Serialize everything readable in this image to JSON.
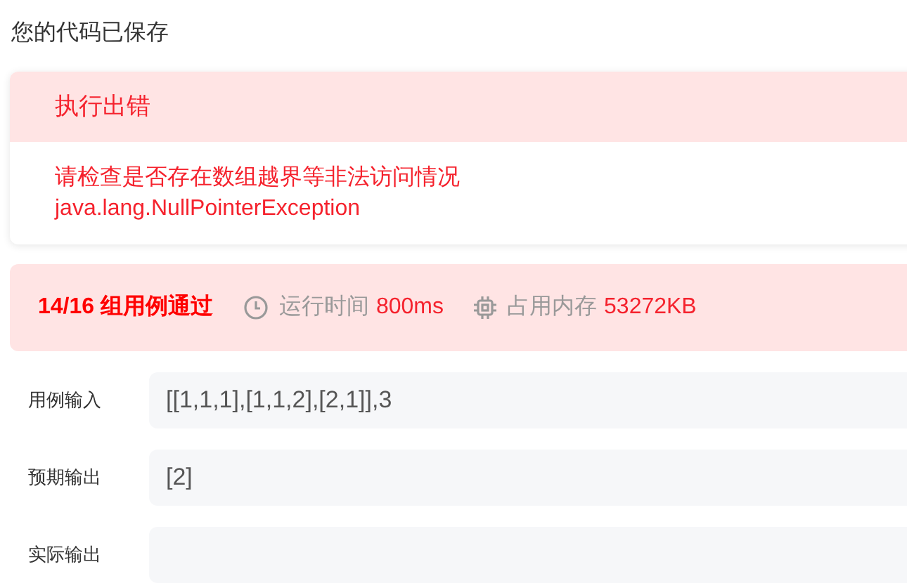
{
  "save_notice": "您的代码已保存",
  "error": {
    "title": "执行出错",
    "message": "请检查是否存在数组越界等非法访问情况",
    "exception": "java.lang.NullPointerException"
  },
  "result": {
    "summary": "14/16 组用例通过",
    "time_label": "运行时间",
    "time_value": "800ms",
    "memory_label": "占用内存",
    "memory_value": "53272KB"
  },
  "cases": [
    {
      "label": "用例输入",
      "value": "[[1,1,1],[1,1,2],[2,1]],3"
    },
    {
      "label": "预期输出",
      "value": "[2]"
    },
    {
      "label": "实际输出"
    }
  ]
}
